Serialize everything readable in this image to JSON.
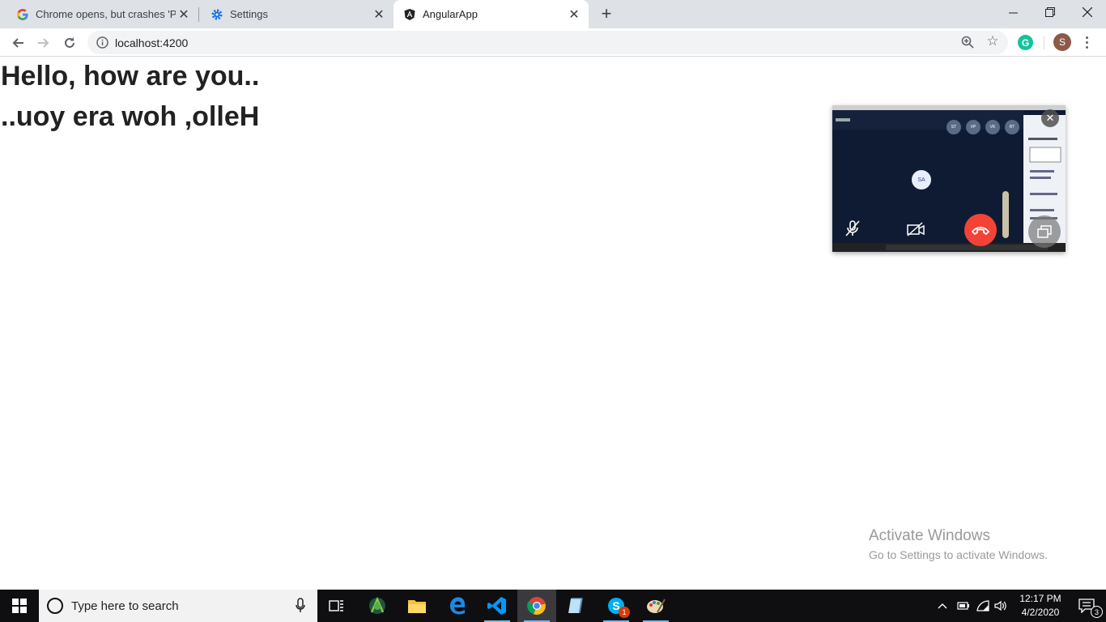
{
  "browser": {
    "tabs": [
      {
        "title": "Chrome opens, but crashes 'Page",
        "icon": "google-g-icon",
        "active": false
      },
      {
        "title": "Settings",
        "icon": "settings-gear-icon",
        "active": false
      },
      {
        "title": "AngularApp",
        "icon": "angular-icon",
        "active": true
      }
    ],
    "new_tab_label": "+",
    "url": "localhost:4200",
    "profile_initial": "S",
    "extension_initial": "G"
  },
  "page": {
    "line1": "Hello, how are you..",
    "line2": "..uoy era woh ,olleH"
  },
  "pip": {
    "participant_initials": [
      "ST",
      "VP",
      "VK",
      "RT"
    ],
    "center_avatar": "SA",
    "accent_color": "#f44336"
  },
  "watermark": {
    "title": "Activate Windows",
    "subtitle": "Go to Settings to activate Windows."
  },
  "taskbar": {
    "search_placeholder": "Type here to search",
    "time": "12:17 PM",
    "date": "4/2/2020",
    "skype_badge": "1",
    "notifications_count": "3"
  }
}
